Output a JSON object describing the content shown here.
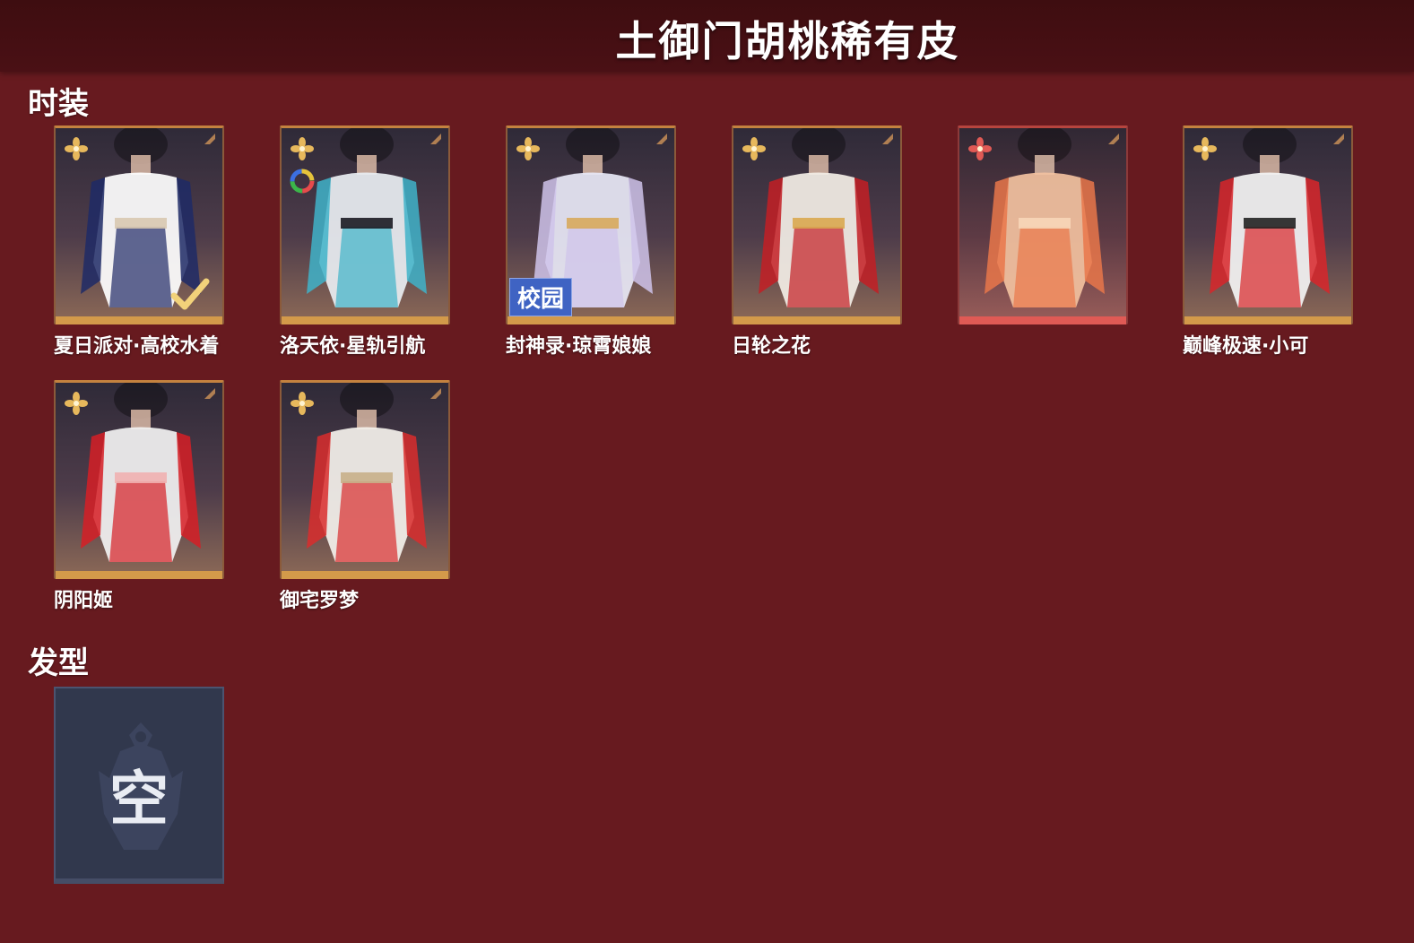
{
  "header": {
    "title": "土御门胡桃稀有皮"
  },
  "sections": {
    "fashion": {
      "title": "时装",
      "items": [
        {
          "name": "夏日派对·高校水着",
          "rarity": "gold",
          "equipped": true
        },
        {
          "name": "洛天依·星轨引航",
          "rarity": "gold",
          "dye": true
        },
        {
          "name": "封神录·琼霄娘娘",
          "rarity": "gold",
          "tag": "校园"
        },
        {
          "name": "日轮之花",
          "rarity": "gold"
        },
        {
          "name": "",
          "rarity": "red"
        },
        {
          "name": "巅峰极速·小可",
          "rarity": "gold"
        },
        {
          "name": "阴阳姬",
          "rarity": "gold"
        },
        {
          "name": "御宅罗梦",
          "rarity": "gold"
        }
      ]
    },
    "hair": {
      "title": "发型",
      "empty_label": "空"
    }
  },
  "colors": {
    "background": "#671a1f",
    "header_bar": "#3e0d10",
    "gold_rarity": "#e7b85c",
    "red_rarity": "#e05a55",
    "empty_slot": "#31384d",
    "tag_blue": "#3f63c3"
  },
  "icons": {
    "gold_rarity": "gold-flower-icon",
    "red_rarity": "red-flower-icon",
    "equipped": "checkmark-icon",
    "dye": "color-wheel-icon",
    "corner": "corner-mark-icon",
    "empty": "empty-slot-emblem-icon"
  }
}
